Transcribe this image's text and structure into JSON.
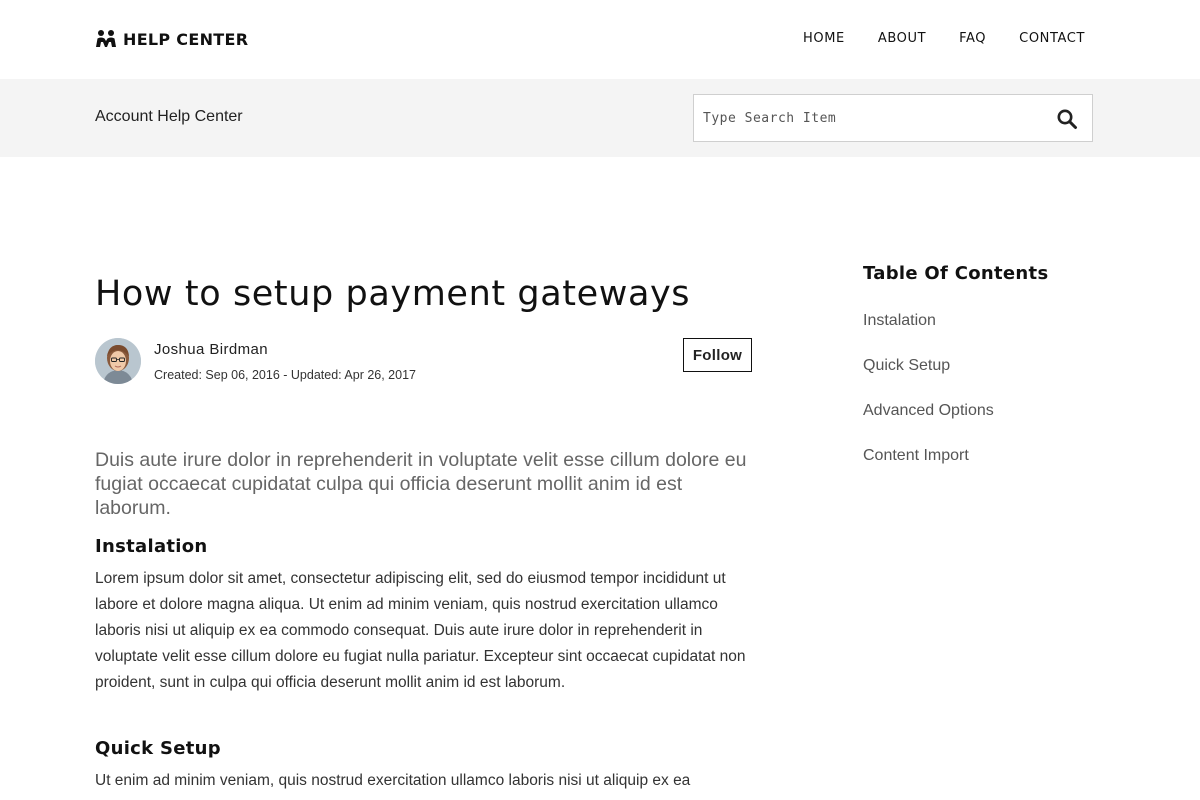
{
  "header": {
    "brand_icon": "people-group-icon",
    "brand": "HELP CENTER",
    "nav": [
      {
        "label": "HOME"
      },
      {
        "label": "ABOUT"
      },
      {
        "label": "FAQ"
      },
      {
        "label": "CONTACT"
      }
    ]
  },
  "subheader": {
    "title": "Account Help Center",
    "search": {
      "placeholder": "Type Search Item",
      "value": "",
      "icon": "search-icon"
    }
  },
  "article": {
    "title": "How to setup payment gateways",
    "author": {
      "name": "Joshua Birdman",
      "meta": "Created: Sep 06, 2016 - Updated: Apr 26, 2017",
      "follow_label": "Follow"
    },
    "intro": "Duis aute irure dolor in reprehenderit in voluptate velit esse cillum dolore eu fugiat occaecat cupidatat culpa qui officia deserunt mollit anim id est laborum.",
    "sections": [
      {
        "heading": "Instalation",
        "body": "Lorem ipsum dolor sit amet, consectetur adipiscing elit, sed do eiusmod tempor incididunt ut labore et dolore magna aliqua. Ut enim ad minim veniam, quis nostrud exercitation ullamco laboris nisi ut aliquip ex ea commodo consequat. Duis aute irure dolor in reprehenderit in voluptate velit esse cillum dolore eu fugiat nulla pariatur. Excepteur sint occaecat cupidatat non proident, sunt in culpa qui officia deserunt mollit anim id est laborum."
      },
      {
        "heading": "Quick Setup",
        "body": "Ut enim ad minim veniam, quis nostrud exercitation ullamco laboris nisi ut aliquip ex ea"
      }
    ]
  },
  "toc": {
    "title": "Table Of Contents",
    "items": [
      {
        "label": "Instalation"
      },
      {
        "label": "Quick Setup"
      },
      {
        "label": "Advanced Options"
      },
      {
        "label": "Content Import"
      }
    ]
  }
}
